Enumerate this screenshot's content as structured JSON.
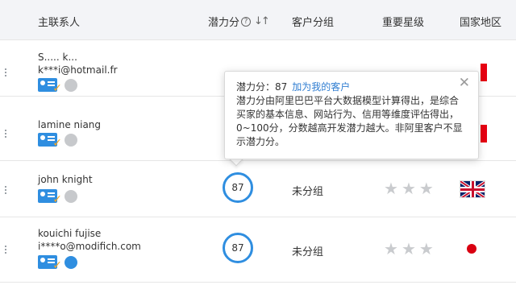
{
  "header": {
    "contact": "主联系人",
    "potential": "潜力分",
    "help_glyph": "?",
    "sort_glyph": "↓↑",
    "group": "客户分组",
    "star": "重要星级",
    "country": "国家地区"
  },
  "rows": [
    {
      "name": "S..... k...",
      "email": "k***i@hotmail.fr",
      "score": "",
      "group": "",
      "country_flag": "red-partial",
      "has_stars": false
    },
    {
      "name": "lamine niang",
      "email": "",
      "score": "",
      "group": "",
      "country_flag": "red-partial",
      "has_stars": false
    },
    {
      "name": "john knight",
      "email": "",
      "score": "87",
      "group": "未分组",
      "country_flag": "uk-flag-icon",
      "stars_filled": 0,
      "stars_total": 3
    },
    {
      "name": "kouichi fujise",
      "email": "i****o@modifich.com",
      "score": "87",
      "group": "未分组",
      "country_flag": "japan-flag-icon",
      "stars_filled": 0,
      "stars_total": 3
    }
  ],
  "popup": {
    "title": "潜力分：87",
    "link": "加为我的客户",
    "body": "潜力分由阿里巴巴平台大数据模型计算得出，是综合买家的基本信息、网站行为、信用等维度评估得出，0~100分，分数越高开发潜力越大。非阿里客户不显示潜力分。",
    "close_glyph": "✕"
  },
  "icons": {
    "star_glyph": "★",
    "check_glyph": "✓"
  },
  "colors": {
    "accent": "#2f8ee0",
    "link": "#2f7dd1",
    "header_bg": "#f3f4f7",
    "star_empty": "#c9cbce"
  }
}
